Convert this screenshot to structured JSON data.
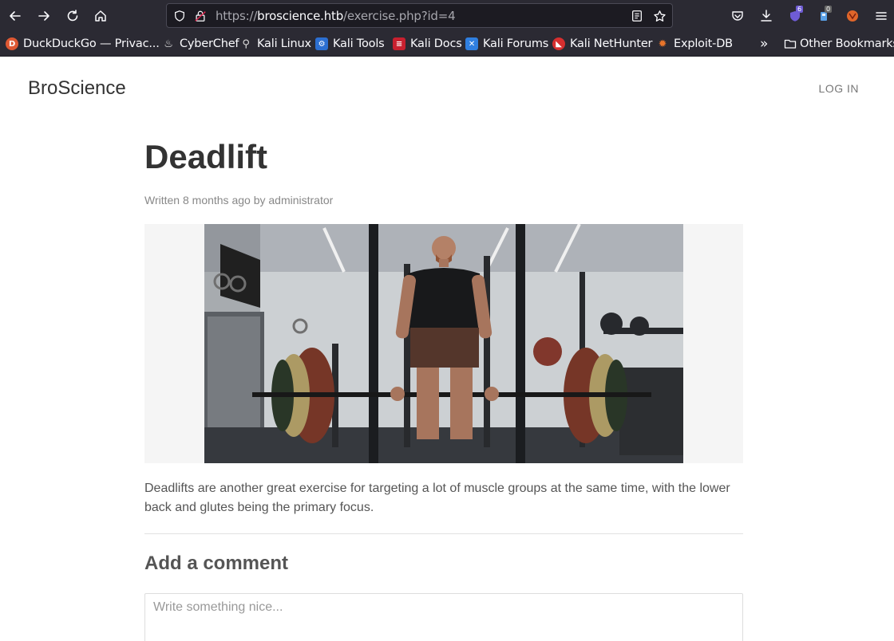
{
  "browser": {
    "url": {
      "scheme": "https://",
      "host": "broscience.htb",
      "path": "/exercise.php?id=4"
    },
    "extension_badges": {
      "ublock": "6",
      "cookie": "0"
    },
    "bookmarks": [
      {
        "label": "DuckDuckGo — Privac...",
        "icon": "duckduckgo-icon"
      },
      {
        "label": "CyberChef",
        "icon": "cyberchef-icon"
      },
      {
        "label": "Kali Linux",
        "icon": "kali-dragon-icon"
      },
      {
        "label": "Kali Tools",
        "icon": "kali-tools-icon"
      },
      {
        "label": "Kali Docs",
        "icon": "kali-docs-icon"
      },
      {
        "label": "Kali Forums",
        "icon": "kali-forums-icon"
      },
      {
        "label": "Kali NetHunter",
        "icon": "nethunter-icon"
      },
      {
        "label": "Exploit-DB",
        "icon": "exploit-db-icon"
      }
    ],
    "overflow_label": "»",
    "other_bookmarks": "Other Bookmarks"
  },
  "site": {
    "brand": "BroScience",
    "login": "LOG IN"
  },
  "article": {
    "title": "Deadlift",
    "meta": "Written 8 months ago by administrator",
    "image_alt": "Man performing a deadlift in a gym",
    "body": "Deadlifts are another great exercise for targeting a lot of muscle groups at the same time, with the lower back and glutes being the primary focus."
  },
  "comments": {
    "heading": "Add a comment",
    "placeholder": "Write something nice..."
  },
  "colors": {
    "chrome_bg": "#2b2a33",
    "url_bg": "#1c1b22",
    "text_dark": "#333333",
    "text_muted": "#888888"
  }
}
